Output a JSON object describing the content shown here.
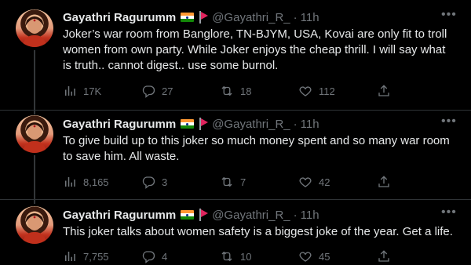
{
  "tweets": [
    {
      "name": "Gayathri Ragurumm",
      "handle": "@Gayathri_R_",
      "time": "11h",
      "text": "Joker’s war room from Banglore, TN-BJYM, USA, Kovai are only fit to troll women from own party. While Joker enjoys the cheap thrill. I will say what is truth.. cannot digest.. use some burnol.",
      "views": "17K",
      "replies": "27",
      "retweets": "18",
      "likes": "112"
    },
    {
      "name": "Gayathri Ragurumm",
      "handle": "@Gayathri_R_",
      "time": "11h",
      "text": "To give build up to this joker so much money spent and so many war room to save him. All waste.",
      "views": "8,165",
      "replies": "3",
      "retweets": "7",
      "likes": "42"
    },
    {
      "name": "Gayathri Ragurumm",
      "handle": "@Gayathri_R_",
      "time": "11h",
      "text": "This joker talks about women safety is a biggest joke of the year. Get a life.",
      "views": "7,755",
      "replies": "4",
      "retweets": "10",
      "likes": "45"
    }
  ],
  "separator": "·",
  "icons": {
    "more": "more-icon",
    "views": "views-icon",
    "reply": "reply-icon",
    "retweet": "retweet-icon",
    "like": "like-icon",
    "share": "share-icon",
    "flag_india": "india-flag-icon",
    "flag_red": "red-flag-icon"
  },
  "colors": {
    "background": "#000000",
    "text": "#e7e9ea",
    "muted": "#71767b",
    "divider": "#2f3336"
  }
}
